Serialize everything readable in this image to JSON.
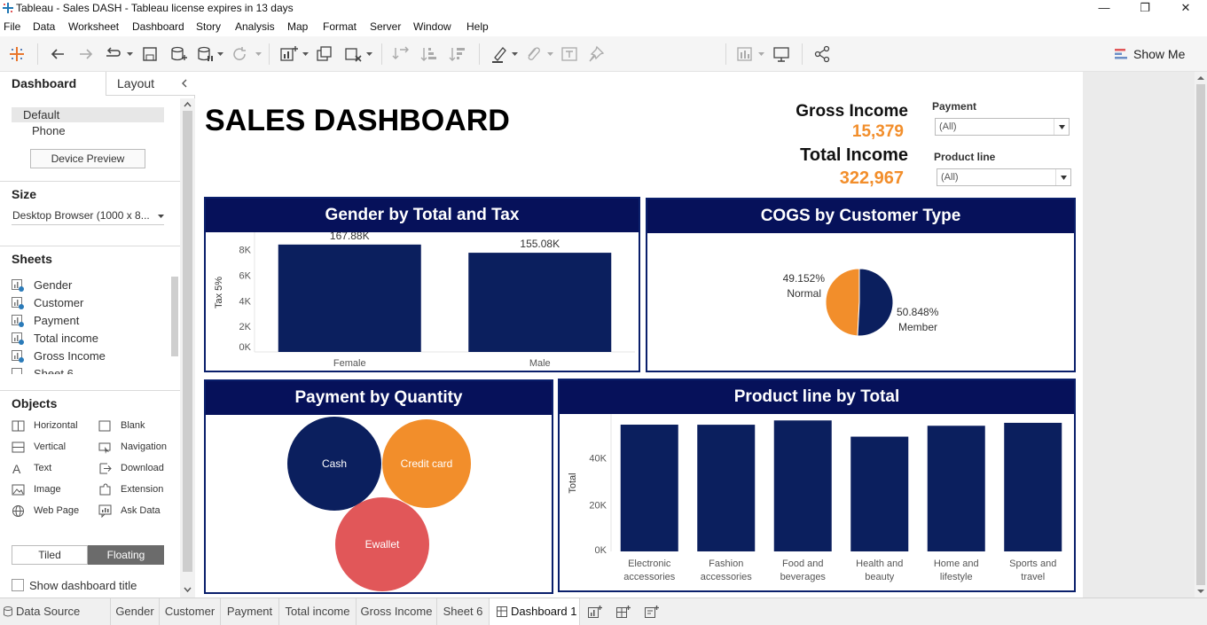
{
  "window": {
    "title": "Tableau - Sales DASH - Tableau license expires in 13 days"
  },
  "menu": [
    "File",
    "Data",
    "Worksheet",
    "Dashboard",
    "Story",
    "Analysis",
    "Map",
    "Format",
    "Server",
    "Window",
    "Help"
  ],
  "toolbar": {
    "show_me_label": "Show Me"
  },
  "left_pane": {
    "tabs": {
      "dashboard": "Dashboard",
      "layout": "Layout"
    },
    "devices": [
      "Default",
      "Phone"
    ],
    "device_preview_label": "Device Preview",
    "size_heading": "Size",
    "size_value": "Desktop Browser (1000 x 8...",
    "sheets_heading": "Sheets",
    "sheets": [
      "Gender",
      "Customer",
      "Payment",
      "Total income",
      "Gross Income",
      "Sheet 6"
    ],
    "objects_heading": "Objects",
    "objects_left": [
      "Horizontal",
      "Vertical",
      "Text",
      "Image",
      "Web Page"
    ],
    "objects_right": [
      "Blank",
      "Navigation",
      "Download",
      "Extension",
      "Ask Data"
    ],
    "tiled_label": "Tiled",
    "floating_label": "Floating",
    "show_title_label": "Show dashboard title"
  },
  "dashboard": {
    "title": "SALES DASHBOARD",
    "gross_income_label": "Gross Income",
    "gross_income_value": "15,379",
    "total_income_label": "Total Income",
    "total_income_value": "322,967",
    "filters": {
      "payment_label": "Payment",
      "payment_value": "(All)",
      "product_line_label": "Product line",
      "product_line_value": "(All)"
    },
    "colors": {
      "navy": "#0b1f5e",
      "orange": "#f28e2b",
      "red": "#e15759",
      "header": "#06115a"
    }
  },
  "chart_data": [
    {
      "type": "bar",
      "title": "Gender by Total and Tax",
      "categories": [
        "Female",
        "Male"
      ],
      "values": [
        8394,
        7754
      ],
      "data_labels": [
        "167.88K",
        "155.08K"
      ],
      "ylabel": "Tax 5%",
      "yticks": [
        "0K",
        "2K",
        "4K",
        "6K",
        "8K"
      ],
      "ylim": [
        0,
        8800
      ]
    },
    {
      "type": "pie",
      "title": "COGS by Customer Type",
      "slices": [
        {
          "label": "Normal",
          "pct_label": "49.152%",
          "value": 49.152,
          "color": "#f28e2b"
        },
        {
          "label": "Member",
          "pct_label": "50.848%",
          "value": 50.848,
          "color": "#0b1f5e"
        }
      ]
    },
    {
      "type": "bubble",
      "title": "Payment by Quantity",
      "bubbles": [
        {
          "label": "Cash",
          "color": "#0b1f5e"
        },
        {
          "label": "Credit card",
          "color": "#f28e2b"
        },
        {
          "label": "Ewallet",
          "color": "#e15759"
        }
      ]
    },
    {
      "type": "bar",
      "title": "Product line by Total",
      "categories": [
        "Electronic accessories",
        "Fashion accessories",
        "Food and beverages",
        "Health and beauty",
        "Home and lifestyle",
        "Sports and travel"
      ],
      "category_lines": [
        [
          "Electronic",
          "accessories"
        ],
        [
          "Fashion",
          "accessories"
        ],
        [
          "Food and",
          "beverages"
        ],
        [
          "Health and",
          "beauty"
        ],
        [
          "Home and",
          "lifestyle"
        ],
        [
          "Sports and",
          "travel"
        ]
      ],
      "values": [
        54338,
        54306,
        56145,
        49194,
        53862,
        55123
      ],
      "ylabel": "Total",
      "yticks": [
        "0K",
        "20K",
        "40K"
      ],
      "ylim": [
        0,
        57000
      ]
    }
  ],
  "bottom_tabs": [
    "Data Source",
    "Gender",
    "Customer",
    "Payment",
    "Total income",
    "Gross Income",
    "Sheet 6",
    "Dashboard 1"
  ]
}
